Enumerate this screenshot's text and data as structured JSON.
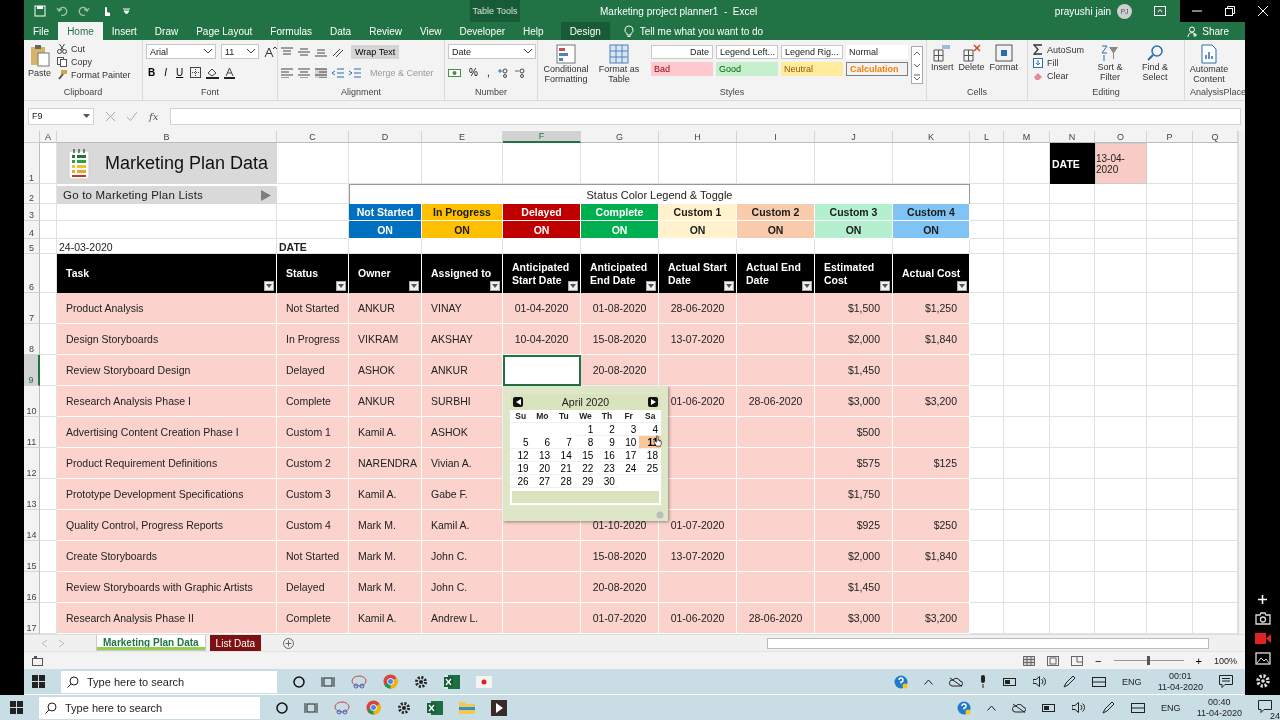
{
  "window": {
    "context_tab": "Table Tools",
    "title": "Marketing project planner1  -  Excel",
    "user": "prayushi jain",
    "user_initials": "PJ"
  },
  "menu_tabs": [
    {
      "label": "File",
      "selected": false,
      "kind": "standard"
    },
    {
      "label": "Home",
      "selected": true,
      "kind": "standard"
    },
    {
      "label": "Insert",
      "selected": false,
      "kind": "standard"
    },
    {
      "label": "Draw",
      "selected": false,
      "kind": "standard"
    },
    {
      "label": "Page Layout",
      "selected": false,
      "kind": "standard"
    },
    {
      "label": "Formulas",
      "selected": false,
      "kind": "standard"
    },
    {
      "label": "Data",
      "selected": false,
      "kind": "standard"
    },
    {
      "label": "Review",
      "selected": false,
      "kind": "standard"
    },
    {
      "label": "View",
      "selected": false,
      "kind": "standard"
    },
    {
      "label": "Developer",
      "selected": false,
      "kind": "standard"
    },
    {
      "label": "Help",
      "selected": false,
      "kind": "standard"
    },
    {
      "label": "Design",
      "selected": false,
      "kind": "contextual"
    }
  ],
  "tell_me": "Tell me what you want to do",
  "share": "Share",
  "ribbon": {
    "clipboard": {
      "paste": "Paste",
      "cut": "Cut",
      "copy": "Copy",
      "format_painter": "Format Painter",
      "label": "Clipboard"
    },
    "font": {
      "name": "Arial",
      "size": "11",
      "bold": "B",
      "italic": "I",
      "underline": "U",
      "label": "Font"
    },
    "alignment": {
      "wrap_text": "Wrap Text",
      "merge_center": "Merge & Center",
      "label": "Alignment"
    },
    "number": {
      "format": "Date",
      "percent": "%",
      "comma": ",",
      "label": "Number"
    },
    "styles": {
      "conditional": "Conditional Formatting",
      "format_table": "Format as Table",
      "label": "Styles",
      "cells": [
        {
          "label": "Date",
          "kind": "date"
        },
        {
          "label": "Legend Left...",
          "kind": "plain"
        },
        {
          "label": "Legend Rig...",
          "kind": "plain"
        },
        {
          "label": "Normal",
          "kind": "normal"
        },
        {
          "label": "Bad",
          "kind": "bad"
        },
        {
          "label": "Good",
          "kind": "good"
        },
        {
          "label": "Neutral",
          "kind": "neutral"
        },
        {
          "label": "Calculation",
          "kind": "calculation"
        }
      ]
    },
    "cells": {
      "insert": "Insert",
      "delete": "Delete",
      "format": "Format",
      "label": "Cells"
    },
    "editing": {
      "autosum": "AutoSum",
      "fill": "Fill",
      "clear": "Clear",
      "sort_filter": "Sort & Filter",
      "find_select": "Find & Select",
      "label": "Editing"
    },
    "addin": {
      "automate": "Automate Content",
      "label": "AnalysisPlace"
    }
  },
  "formula_bar": {
    "name_box": "F9",
    "function_label": "fx"
  },
  "columns": [
    {
      "label": "A",
      "selected": false
    },
    {
      "label": "B",
      "selected": false
    },
    {
      "label": "C",
      "selected": false
    },
    {
      "label": "D",
      "selected": false
    },
    {
      "label": "E",
      "selected": false
    },
    {
      "label": "F",
      "selected": true
    },
    {
      "label": "G",
      "selected": false
    },
    {
      "label": "H",
      "selected": false
    },
    {
      "label": "I",
      "selected": false
    },
    {
      "label": "J",
      "selected": false
    },
    {
      "label": "K",
      "selected": false
    },
    {
      "label": "L",
      "selected": false
    },
    {
      "label": "M",
      "selected": false
    },
    {
      "label": "N",
      "selected": false
    },
    {
      "label": "O",
      "selected": false
    },
    {
      "label": "P",
      "selected": false
    },
    {
      "label": "Q",
      "selected": false
    }
  ],
  "rows": [
    {
      "label": "1",
      "selected": false
    },
    {
      "label": "2",
      "selected": false
    },
    {
      "label": "3",
      "selected": false
    },
    {
      "label": "4",
      "selected": false
    },
    {
      "label": "5",
      "selected": false
    },
    {
      "label": "6",
      "selected": false
    },
    {
      "label": "7",
      "selected": false
    },
    {
      "label": "8",
      "selected": false
    },
    {
      "label": "9",
      "selected": true
    },
    {
      "label": "10",
      "selected": false
    },
    {
      "label": "11",
      "selected": false
    },
    {
      "label": "12",
      "selected": false
    },
    {
      "label": "13",
      "selected": false
    },
    {
      "label": "14",
      "selected": false
    },
    {
      "label": "15",
      "selected": false
    },
    {
      "label": "16",
      "selected": false
    },
    {
      "label": "17",
      "selected": false
    }
  ],
  "sheet": {
    "title": "Marketing Plan Data",
    "link": "Go to Marketing Plan Lists",
    "date_value": "24-03-2020",
    "date_label": "DATE",
    "date_box": {
      "label": "DATE",
      "value": "13-04-2020"
    },
    "legend": {
      "title": "Status Color Legend & Toggle",
      "items": [
        {
          "label": "Not Started",
          "toggle": "ON",
          "color": "#0070c0"
        },
        {
          "label": "In Progress",
          "toggle": "ON",
          "color": "#ffc000"
        },
        {
          "label": "Delayed",
          "toggle": "ON",
          "color": "#c00000"
        },
        {
          "label": "Complete",
          "toggle": "ON",
          "color": "#00b050"
        },
        {
          "label": "Custom 1",
          "toggle": "ON",
          "color": "#fff2cc"
        },
        {
          "label": "Custom 2",
          "toggle": "ON",
          "color": "#f8cbad"
        },
        {
          "label": "Custom 3",
          "toggle": "ON",
          "color": "#b4f0d0"
        },
        {
          "label": "Custom 4",
          "toggle": "ON",
          "color": "#7fc4f5"
        }
      ]
    },
    "table": {
      "columns": [
        "Task",
        "Status",
        "Owner",
        "Assigned to",
        "Anticipated Start Date",
        "Anticipated End Date",
        "Actual Start Date",
        "Actual End Date",
        "Estimated Cost",
        "Actual Cost"
      ],
      "rows": [
        {
          "task": "Product Analysis",
          "status": "Not Started",
          "owner": "ANKUR",
          "assigned_to": "VINAY",
          "anticipated_start": "01-04-2020",
          "anticipated_end": "01-08-2020",
          "actual_start": "28-06-2020",
          "estimated_cost": "$1,500",
          "actual_cost": "$1,250"
        },
        {
          "task": "Design Storyboards",
          "status": "In Progress",
          "owner": "VIKRAM",
          "assigned_to": "AKSHAY",
          "anticipated_start": "10-04-2020",
          "anticipated_end": "15-08-2020",
          "actual_start": "13-07-2020",
          "estimated_cost": "$2,000",
          "actual_cost": "$1,840"
        },
        {
          "task": "Review Storyboard Design",
          "status": "Delayed",
          "owner": "ASHOK",
          "assigned_to": "ANKUR",
          "anticipated_end": "20-08-2020",
          "estimated_cost": "$1,450"
        },
        {
          "task": "Research Analysis Phase I",
          "status": "Complete",
          "owner": "ANKUR",
          "assigned_to": "SURBHI",
          "actual_start": "01-06-2020",
          "actual_end": "28-06-2020",
          "estimated_cost": "$3,000",
          "actual_cost": "$3,200"
        },
        {
          "task": "Advertising Content Creation Phase I",
          "status": "Custom 1",
          "owner": "Kamil A.",
          "assigned_to": "ASHOK",
          "estimated_cost": "$500"
        },
        {
          "task": "Product Requirement Definitions",
          "status": "Custom 2",
          "owner": "NARENDRA",
          "assigned_to": "Vivian A.",
          "estimated_cost": "$575",
          "actual_cost": "$125"
        },
        {
          "task": "Prototype Development Specifications",
          "status": "Custom 3",
          "owner": "Kamil A.",
          "assigned_to": "Gabe F.",
          "estimated_cost": "$1,750"
        },
        {
          "task": "Quality Control, Progress Reports",
          "status": "Custom 4",
          "owner": "Mark M.",
          "assigned_to": "Kamil A.",
          "anticipated_end": "01-10-2020",
          "actual_start": "01-07-2020",
          "estimated_cost": "$925",
          "actual_cost": "$250"
        },
        {
          "task": "Create Storyboards",
          "status": "Not Started",
          "owner": "Mark M.",
          "assigned_to": "John C.",
          "anticipated_end": "15-08-2020",
          "actual_start": "13-07-2020",
          "estimated_cost": "$2,000",
          "actual_cost": "$1,840"
        },
        {
          "task": "Review Storyboards with Graphic Artists",
          "status": "Delayed",
          "owner": "Mark M.",
          "assigned_to": "John C.",
          "anticipated_end": "20-08-2020",
          "estimated_cost": "$1,450"
        },
        {
          "task": "Research Analysis Phase II",
          "status": "Complete",
          "owner": "Kamil A.",
          "assigned_to": "Andrew L.",
          "anticipated_end": "01-07-2020",
          "actual_start": "01-06-2020",
          "actual_end": "28-06-2020",
          "estimated_cost": "$3,000",
          "actual_cost": "$3,200"
        }
      ]
    }
  },
  "calendar": {
    "month": "April 2020",
    "weekdays": [
      "Su",
      "Mo",
      "Tu",
      "We",
      "Th",
      "Fr",
      "Sa"
    ],
    "weeks": [
      [
        {
          "day": "1",
          "selected": false
        },
        {
          "day": "2",
          "selected": false
        },
        {
          "day": "3",
          "selected": false
        },
        {
          "day": "4",
          "selected": false
        }
      ],
      [
        {
          "day": "5",
          "selected": false
        },
        {
          "day": "6",
          "selected": false
        },
        {
          "day": "7",
          "selected": false
        },
        {
          "day": "8",
          "selected": false
        },
        {
          "day": "9",
          "selected": false
        },
        {
          "day": "10",
          "selected": false
        },
        {
          "day": "11",
          "selected": true
        }
      ],
      [
        {
          "day": "12",
          "selected": false
        },
        {
          "day": "13",
          "selected": false
        },
        {
          "day": "14",
          "selected": false
        },
        {
          "day": "15",
          "selected": false
        },
        {
          "day": "16",
          "selected": false
        },
        {
          "day": "17",
          "selected": false
        },
        {
          "day": "18",
          "selected": false
        }
      ],
      [
        {
          "day": "19",
          "selected": false
        },
        {
          "day": "20",
          "selected": false
        },
        {
          "day": "21",
          "selected": false
        },
        {
          "day": "22",
          "selected": false
        },
        {
          "day": "23",
          "selected": false
        },
        {
          "day": "24",
          "selected": false
        },
        {
          "day": "25",
          "selected": false
        }
      ],
      [
        {
          "day": "26",
          "selected": false
        },
        {
          "day": "27",
          "selected": false
        },
        {
          "day": "28",
          "selected": false
        },
        {
          "day": "29",
          "selected": false
        },
        {
          "day": "30",
          "selected": false
        }
      ]
    ]
  },
  "sheet_tabs": [
    {
      "label": "Marketing Plan Data",
      "selected": true,
      "color": "#92d050"
    },
    {
      "label": "List Data",
      "selected": false,
      "color": "#7b1111"
    }
  ],
  "status_bar": {
    "zoom_out": "−",
    "zoom_in": "+",
    "zoom": "100%",
    "level": 0.5
  },
  "taskbars": [
    {
      "search_placeholder": "Type here to search",
      "language": "ENG",
      "time": "00:01",
      "date": "11-04-2020"
    },
    {
      "search_placeholder": "Type here to search",
      "language": "ENG",
      "time": "00:40",
      "date": "11-04-2020",
      "notifications": "24"
    }
  ]
}
